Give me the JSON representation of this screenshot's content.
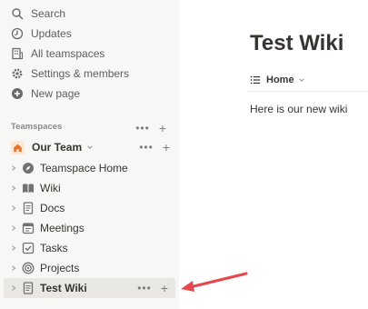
{
  "sidebar": {
    "top_items": [
      {
        "label": "Search",
        "icon": "search-icon"
      },
      {
        "label": "Updates",
        "icon": "clock-icon"
      },
      {
        "label": "All teamspaces",
        "icon": "building-icon"
      },
      {
        "label": "Settings & members",
        "icon": "gear-icon"
      },
      {
        "label": "New page",
        "icon": "plus-circle-icon"
      }
    ],
    "section_label": "Teamspaces",
    "section_actions": {
      "more": "•••",
      "add": "+"
    },
    "team": {
      "label": "Our Team",
      "icon": "house-icon",
      "more": "•••",
      "add": "+"
    },
    "pages": [
      {
        "label": "Teamspace Home",
        "icon": "compass-icon"
      },
      {
        "label": "Wiki",
        "icon": "book-icon"
      },
      {
        "label": "Docs",
        "icon": "document-icon"
      },
      {
        "label": "Meetings",
        "icon": "calendar-icon"
      },
      {
        "label": "Tasks",
        "icon": "checkbox-icon"
      },
      {
        "label": "Projects",
        "icon": "target-icon"
      },
      {
        "label": "Test Wiki",
        "icon": "document-icon",
        "selected": true,
        "more": "•••",
        "add": "+"
      }
    ]
  },
  "main": {
    "title": "Test Wiki",
    "view_label": "Home",
    "body_text": "Here is our new wiki"
  },
  "colors": {
    "sidebar_bg": "#f7f7f5",
    "selected_bg": "#e8e7e4",
    "arrow": "#e5484d",
    "text": "#37352f"
  }
}
